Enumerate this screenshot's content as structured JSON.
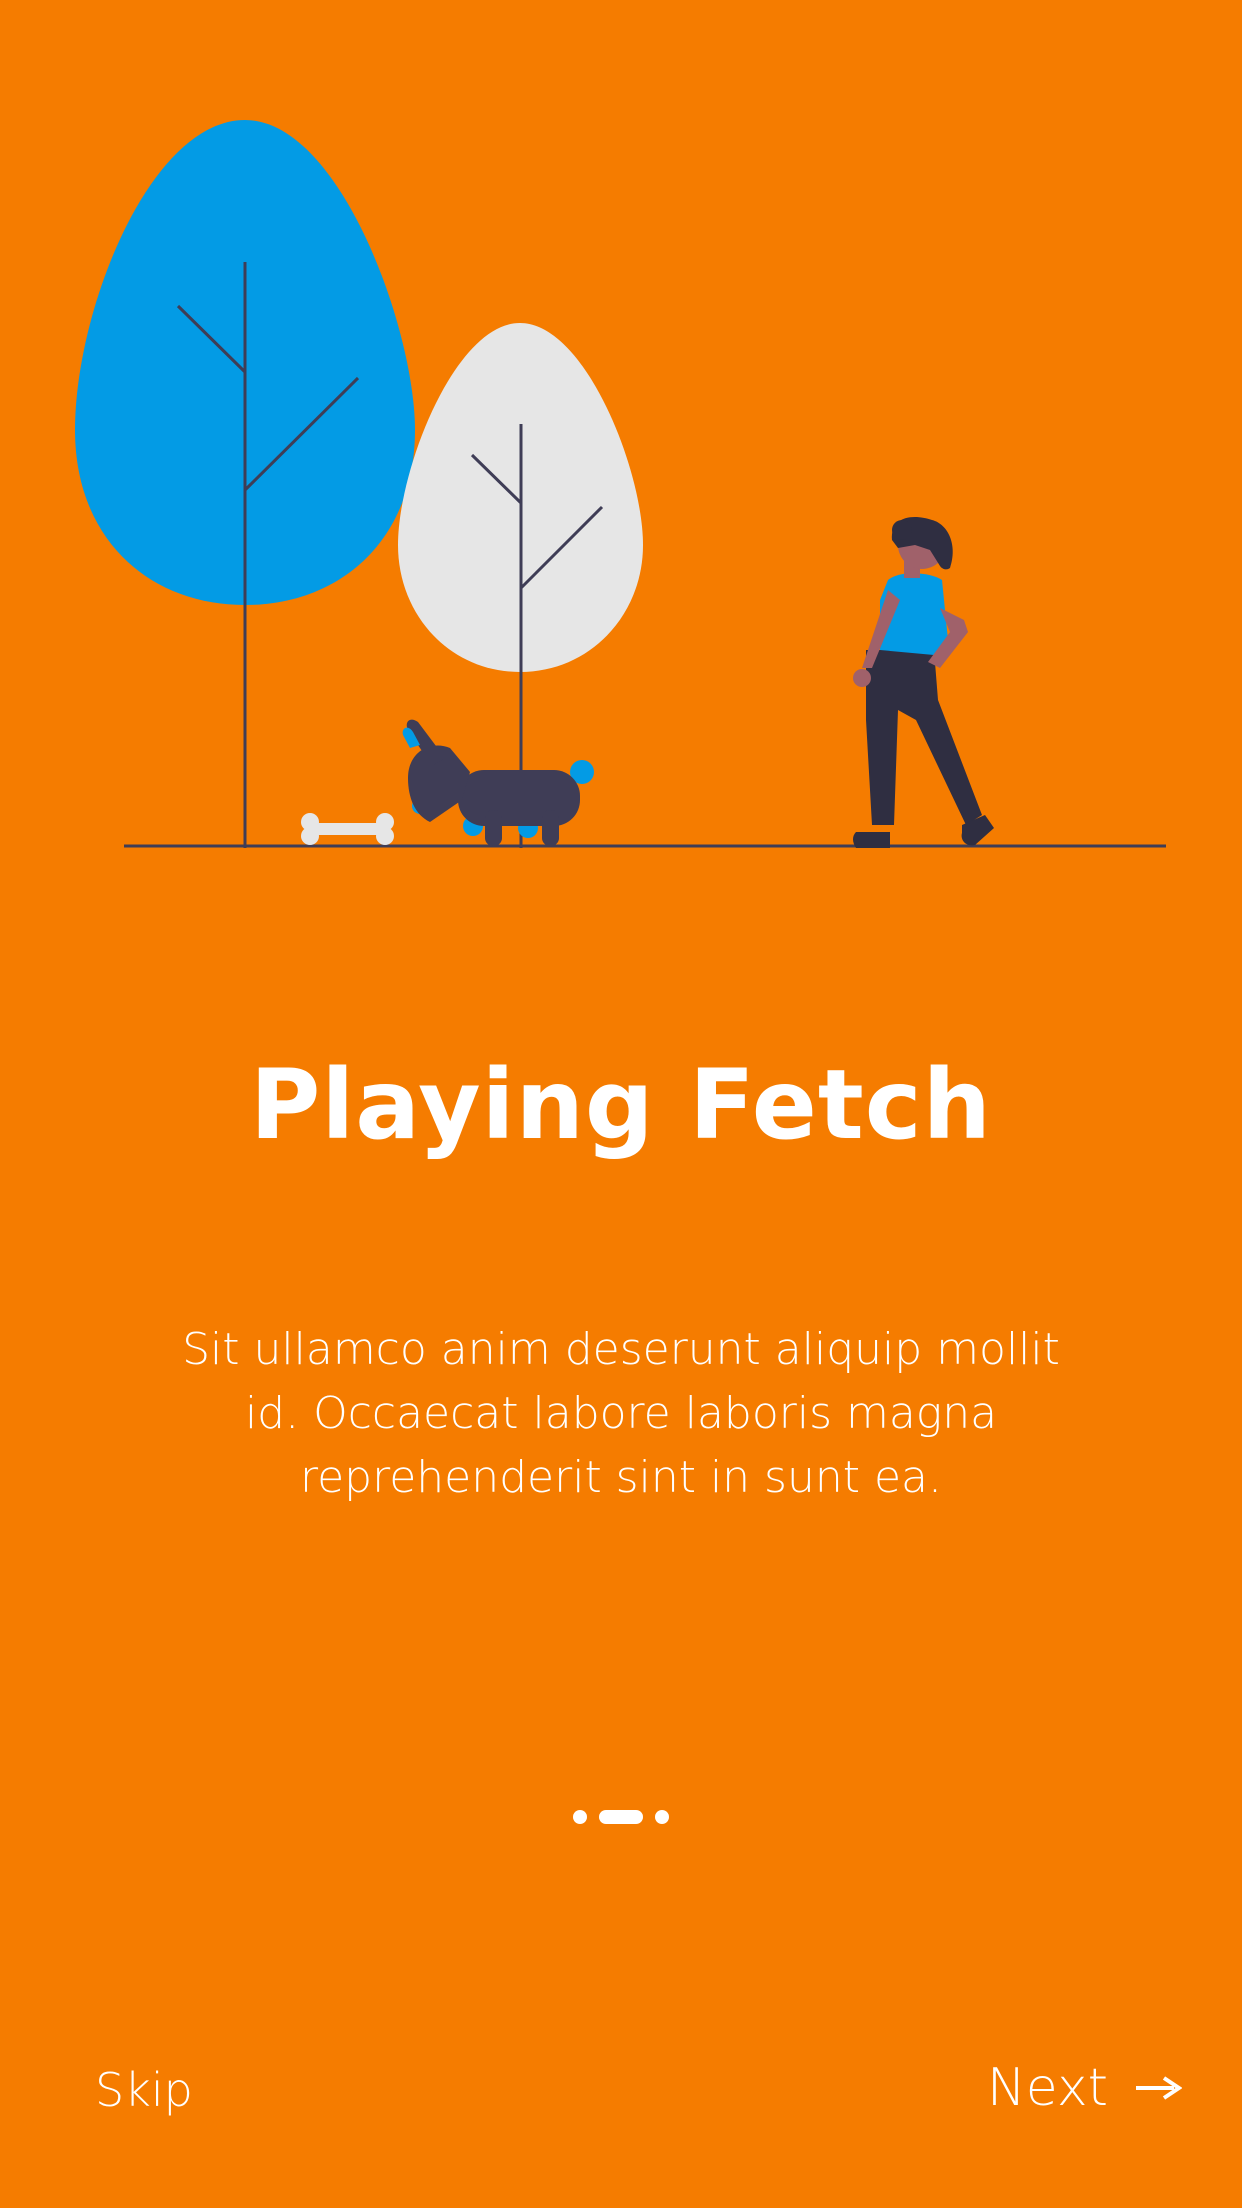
{
  "onboarding": {
    "title": "Playing Fetch",
    "description": "Sit ullamco anim deserunt aliquip mollit id. Occaecat labore laboris magna reprehenderit sint in sunt ea.",
    "page_indicator": {
      "total_pages": 3,
      "current_page": 2
    }
  },
  "footer": {
    "skip_label": "Skip",
    "next_label": "Next",
    "next_icon": "arrow-right-icon"
  },
  "colors": {
    "background": "#F57C00",
    "text": "#FFFFFF",
    "accent_blue": "#039BE5",
    "tree_light": "#E6E6E6",
    "dark_figure": "#3F3D56"
  }
}
